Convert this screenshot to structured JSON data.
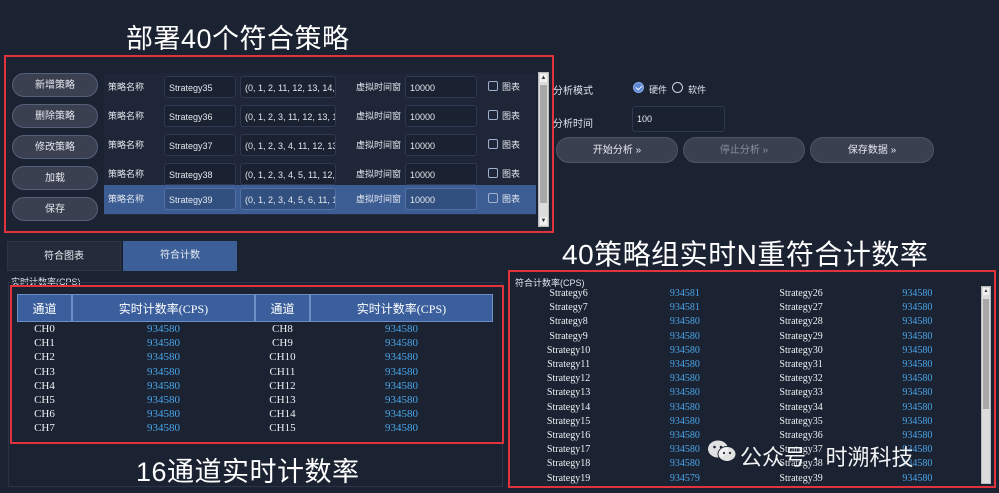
{
  "annotations": {
    "top_title": "部署40个符合策略",
    "coinc_title": "40策略组实时N重符合计数率",
    "channel_title": "16通道实时计数率"
  },
  "left_buttons": [
    "新增策略",
    "删除策略",
    "修改策略",
    "加载",
    "保存"
  ],
  "strategy_rows": [
    {
      "label": "策略名称",
      "name": "Strategy35",
      "channels": "(0, 1, 2, 11, 12, 13, 14, 1",
      "time_label": "虚拟时间窗",
      "time": "10000",
      "chart_label": "图表",
      "selected": false
    },
    {
      "label": "策略名称",
      "name": "Strategy36",
      "channels": "(0, 1, 2, 3, 11, 12, 13, 14",
      "time_label": "虚拟时间窗",
      "time": "10000",
      "chart_label": "图表",
      "selected": false
    },
    {
      "label": "策略名称",
      "name": "Strategy37",
      "channels": "(0, 1, 2, 3, 4, 11, 12, 13,",
      "time_label": "虚拟时间窗",
      "time": "10000",
      "chart_label": "图表",
      "selected": false
    },
    {
      "label": "策略名称",
      "name": "Strategy38",
      "channels": "(0, 1, 2, 3, 4, 5, 11, 12, 1",
      "time_label": "虚拟时间窗",
      "time": "10000",
      "chart_label": "图表",
      "selected": false
    },
    {
      "label": "策略名称",
      "name": "Strategy39",
      "channels": "(0, 1, 2, 3, 4, 5, 6, 11, 12",
      "time_label": "虚拟时间窗",
      "time": "10000",
      "chart_label": "图表",
      "selected": true
    }
  ],
  "analysis": {
    "mode_label": "分析模式",
    "hardware": "硬件",
    "software": "软件",
    "mode_selected": "硬件",
    "time_label": "分析时间",
    "time_value": "100",
    "start": "开始分析 »",
    "stop": "停止分析 »",
    "save": "保存数据 »"
  },
  "tabs": [
    {
      "label": "符合图表",
      "active": false
    },
    {
      "label": "符合计数",
      "active": true
    }
  ],
  "channel_section_label": "实时计数率(CPS)",
  "channel_table": {
    "headers": [
      "通道",
      "实时计数率(CPS)",
      "通道",
      "实时计数率(CPS)"
    ],
    "rows": [
      [
        "CH0",
        "934580",
        "CH8",
        "934580"
      ],
      [
        "CH1",
        "934580",
        "CH9",
        "934580"
      ],
      [
        "CH2",
        "934580",
        "CH10",
        "934580"
      ],
      [
        "CH3",
        "934580",
        "CH11",
        "934580"
      ],
      [
        "CH4",
        "934580",
        "CH12",
        "934580"
      ],
      [
        "CH5",
        "934580",
        "CH13",
        "934580"
      ],
      [
        "CH6",
        "934580",
        "CH14",
        "934580"
      ],
      [
        "CH7",
        "934580",
        "CH15",
        "934580"
      ]
    ]
  },
  "coinc_section_label": "符合计数率(CPS)",
  "coinc_table": {
    "rows": [
      [
        "Strategy6",
        "934581",
        "Strategy26",
        "934580"
      ],
      [
        "Strategy7",
        "934581",
        "Strategy27",
        "934580"
      ],
      [
        "Strategy8",
        "934580",
        "Strategy28",
        "934580"
      ],
      [
        "Strategy9",
        "934580",
        "Strategy29",
        "934580"
      ],
      [
        "Strategy10",
        "934580",
        "Strategy30",
        "934580"
      ],
      [
        "Strategy11",
        "934580",
        "Strategy31",
        "934580"
      ],
      [
        "Strategy12",
        "934580",
        "Strategy32",
        "934580"
      ],
      [
        "Strategy13",
        "934580",
        "Strategy33",
        "934580"
      ],
      [
        "Strategy14",
        "934580",
        "Strategy34",
        "934580"
      ],
      [
        "Strategy15",
        "934580",
        "Strategy35",
        "934580"
      ],
      [
        "Strategy16",
        "934580",
        "Strategy36",
        "934580"
      ],
      [
        "Strategy17",
        "934580",
        "Strategy37",
        "934580"
      ],
      [
        "Strategy18",
        "934580",
        "Strategy38",
        "934580"
      ],
      [
        "Strategy19",
        "934579",
        "Strategy39",
        "934580"
      ]
    ]
  },
  "watermark": {
    "text": "公众号 · 时溯科技"
  },
  "colors": {
    "background": "#1b2231",
    "accent_blue": "#4aa6ea",
    "highlight_row": "#3b5d94",
    "annotation_red": "#e0333c"
  }
}
